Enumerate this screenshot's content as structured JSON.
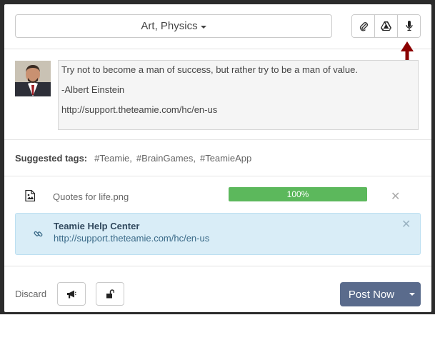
{
  "header": {
    "subject_selector": "Art, Physics",
    "icons": [
      "paperclip-icon",
      "google-drive-icon",
      "microphone-icon"
    ]
  },
  "post": {
    "lines": [
      "Try not to become a man of success, but rather try to be a man of value.",
      "-Albert Einstein",
      "http://support.theteamie.com/hc/en-us"
    ]
  },
  "tags": {
    "label": "Suggested tags:",
    "items": [
      "#Teamie,",
      "#BrainGames,",
      "#TeamieApp"
    ]
  },
  "attachment": {
    "file_name": "Quotes for life.png",
    "progress_label": "100%",
    "progress_value": 100,
    "progress_color": "#5cb85c"
  },
  "link_preview": {
    "title": "Teamie Help Center",
    "url": "http://support.theteamie.com/hc/en-us"
  },
  "footer": {
    "discard_label": "Discard",
    "post_label": "Post Now",
    "post_color": "#5a6b8c"
  },
  "annotation": {
    "arrow_color": "#8b0000"
  }
}
